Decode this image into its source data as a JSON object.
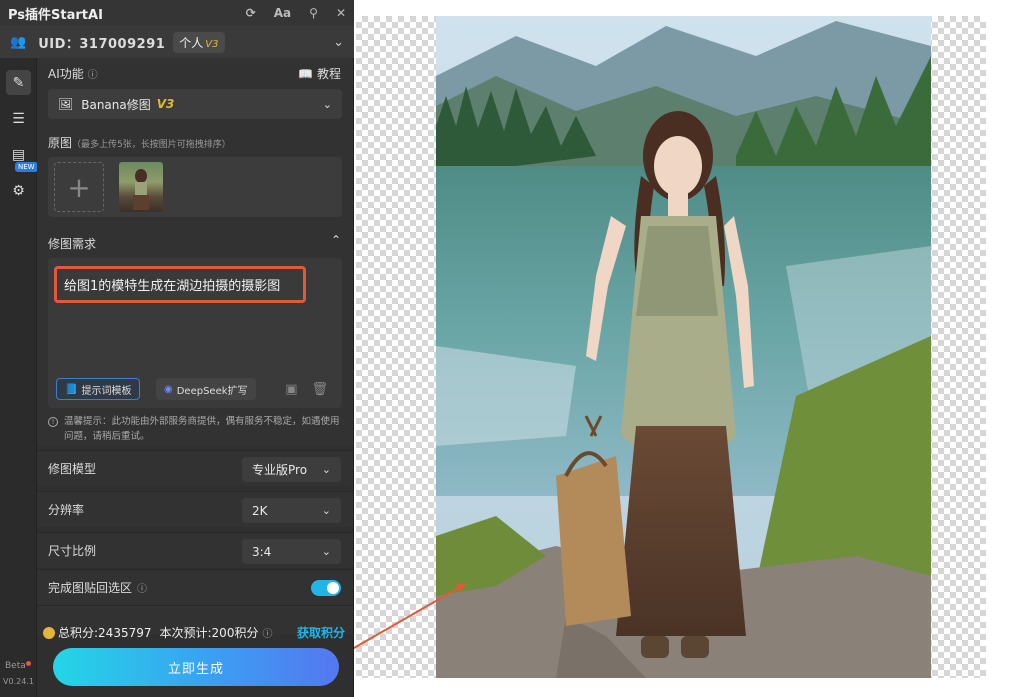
{
  "app": {
    "title": "Ps插件StartAI"
  },
  "titlebar_icons": [
    "refresh-icon",
    "font-size-icon",
    "pin-icon",
    "close-icon"
  ],
  "user": {
    "uid_label": "UID：317009291",
    "plan": "个人",
    "plan_version": "V3"
  },
  "sidebar": {
    "new_tag": "NEW",
    "beta": "Beta",
    "version": "V0.24.1"
  },
  "ai": {
    "label": "AI功能",
    "tutorial": "教程",
    "feature": "Banana修图",
    "feature_version": "V3"
  },
  "source": {
    "label": "原图",
    "hint": "（最多上传5张，长按图片可拖拽排序）"
  },
  "request": {
    "label": "修图需求",
    "text": "给图1的模特生成在湖边拍摄的摄影图",
    "template_button": "提示词模板",
    "deepseek_button": "DeepSeek扩写",
    "tip": "温馨提示：此功能由外部服务商提供，偶有服务不稳定，如遇使用问题，请稍后重试。"
  },
  "settings": {
    "model_label": "修图模型",
    "model_value": "专业版Pro",
    "resolution_label": "分辨率",
    "resolution_value": "2K",
    "ratio_label": "尺寸比例",
    "ratio_value": "3:4",
    "paste_label": "完成图贴回选区",
    "paste_enabled": true
  },
  "footer": {
    "points": "总积分:2435797",
    "estimate": "本次预计:200积分",
    "get_points": "获取积分",
    "generate": "立即生成"
  },
  "colors": {
    "accent": "#22b6e8",
    "highlight_border": "#e05a3a",
    "gold": "#e5b53a"
  }
}
